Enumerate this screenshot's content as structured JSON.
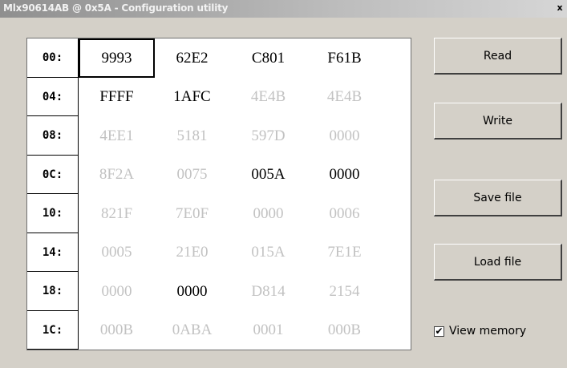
{
  "window": {
    "title": "Mlx90614AB @ 0x5A - Configuration utility",
    "close_glyph": "x"
  },
  "memory": {
    "rows": [
      {
        "addr": "00:",
        "cells": [
          {
            "value": "9993",
            "active": true,
            "selected": true
          },
          {
            "value": "62E2",
            "active": true
          },
          {
            "value": "C801",
            "active": true
          },
          {
            "value": "F61B",
            "active": true
          }
        ]
      },
      {
        "addr": "04:",
        "cells": [
          {
            "value": "FFFF",
            "active": true
          },
          {
            "value": "1AFC",
            "active": true
          },
          {
            "value": "4E4B",
            "active": false
          },
          {
            "value": "4E4B",
            "active": false
          }
        ]
      },
      {
        "addr": "08:",
        "cells": [
          {
            "value": "4EE1",
            "active": false
          },
          {
            "value": "5181",
            "active": false
          },
          {
            "value": "597D",
            "active": false
          },
          {
            "value": "0000",
            "active": false
          }
        ]
      },
      {
        "addr": "0C:",
        "cells": [
          {
            "value": "8F2A",
            "active": false
          },
          {
            "value": "0075",
            "active": false
          },
          {
            "value": "005A",
            "active": true
          },
          {
            "value": "0000",
            "active": true
          }
        ]
      },
      {
        "addr": "10:",
        "cells": [
          {
            "value": "821F",
            "active": false
          },
          {
            "value": "7E0F",
            "active": false
          },
          {
            "value": "0000",
            "active": false
          },
          {
            "value": "0006",
            "active": false
          }
        ]
      },
      {
        "addr": "14:",
        "cells": [
          {
            "value": "0005",
            "active": false
          },
          {
            "value": "21E0",
            "active": false
          },
          {
            "value": "015A",
            "active": false
          },
          {
            "value": "7E1E",
            "active": false
          }
        ]
      },
      {
        "addr": "18:",
        "cells": [
          {
            "value": "0000",
            "active": false
          },
          {
            "value": "0000",
            "active": true
          },
          {
            "value": "D814",
            "active": false
          },
          {
            "value": "2154",
            "active": false
          }
        ]
      },
      {
        "addr": "1C:",
        "cells": [
          {
            "value": "000B",
            "active": false
          },
          {
            "value": "0ABA",
            "active": false
          },
          {
            "value": "0001",
            "active": false
          },
          {
            "value": "000B",
            "active": false
          }
        ]
      }
    ]
  },
  "buttons": {
    "read": "Read",
    "write": "Write",
    "save_file": "Save file",
    "load_file": "Load file"
  },
  "view_memory": {
    "label": "View memory",
    "checked": true
  },
  "colors": {
    "active_text": "#000000",
    "inactive_text": "#c2c2c2",
    "window_bg": "#d4d0c8"
  }
}
